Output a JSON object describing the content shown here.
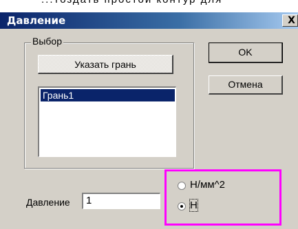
{
  "background_text": "...тоздать простой контур для",
  "window": {
    "title": "Давление",
    "close_label": "X"
  },
  "group": {
    "label": "Выбор",
    "select_face_button": "Указать грань",
    "list_items": [
      "Грань1"
    ]
  },
  "buttons": {
    "ok": "OK",
    "cancel": "Отмена"
  },
  "pressure": {
    "label_first": "Д",
    "label_rest": "авление",
    "value": "1"
  },
  "units": {
    "options": [
      "Н/мм^2",
      "Н"
    ],
    "selected_index": 1
  },
  "colors": {
    "highlight": "#ff00ff",
    "selection": "#0a246a"
  }
}
